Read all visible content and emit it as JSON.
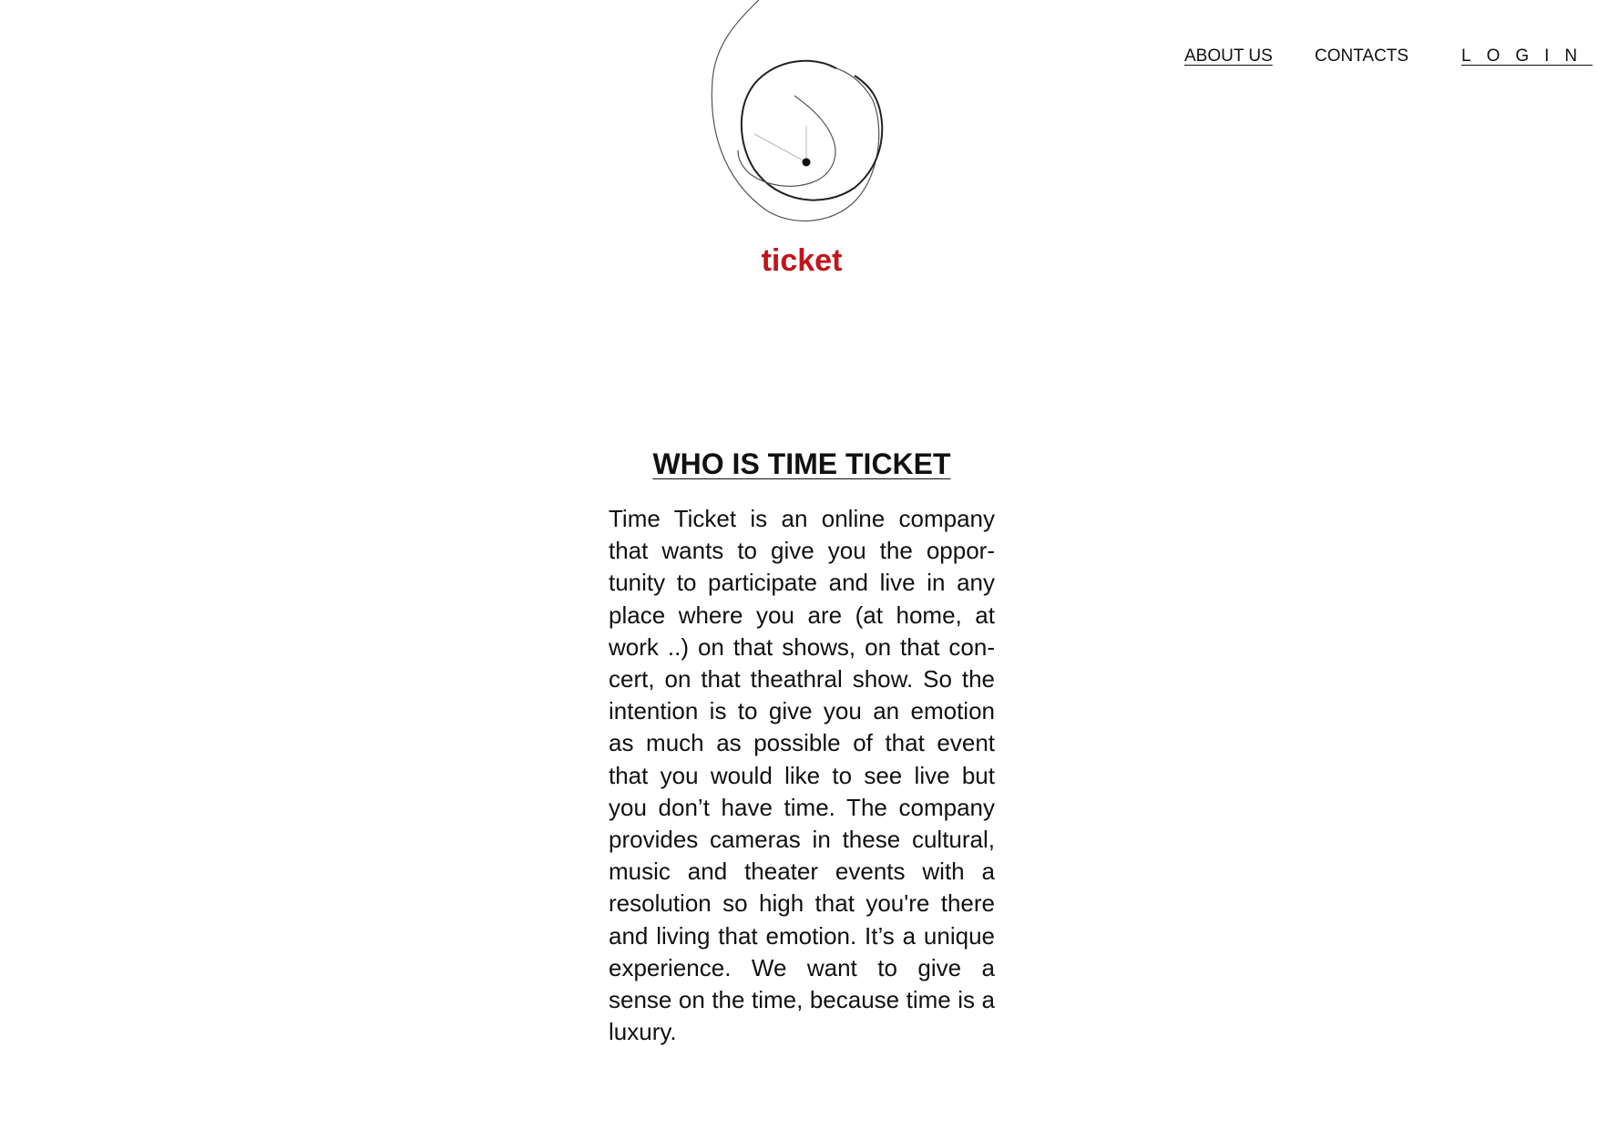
{
  "nav": {
    "about_label": "ABOUT US",
    "contacts_label": "CONTACTS",
    "login_label": "LOGIN"
  },
  "logo": {
    "icon": "clock-spiral-logo",
    "brand_text": "ticket",
    "brand_color": "#c0151b"
  },
  "section": {
    "title": "WHO IS TIME TICKET",
    "body": "Time Ticket is an online company that wants to give you the oppor­tunity to participate and live in any place where you are (at home, at work ..) on that shows, on that con­cert, on that theathral show. So the intention is to give you an emotion as much as possible of that event that you would like to see live but you don’t have time. The company provides cameras in these cultural, music and theater events with a resolution so high that you're there and living that emotion. It’s a unique experience. We want to give a sense on the time, because time is a luxury."
  }
}
